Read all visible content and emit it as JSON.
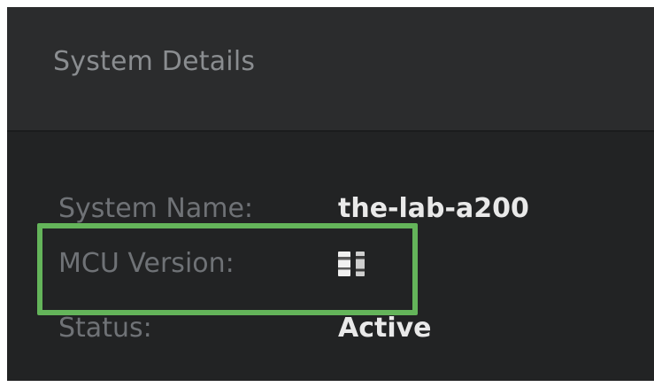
{
  "header": {
    "title": "System Details"
  },
  "details": [
    {
      "label": "System Name:",
      "value": "the-lab-a200"
    },
    {
      "label": "MCU Version:",
      "value": ""
    },
    {
      "label": "Status:",
      "value": "Active"
    }
  ],
  "colors": {
    "panel_bg": "#222324",
    "header_bg": "#2b2c2d",
    "label_text": "#6f7276",
    "value_text": "#e9e9e9",
    "highlight": "#64b45a"
  }
}
